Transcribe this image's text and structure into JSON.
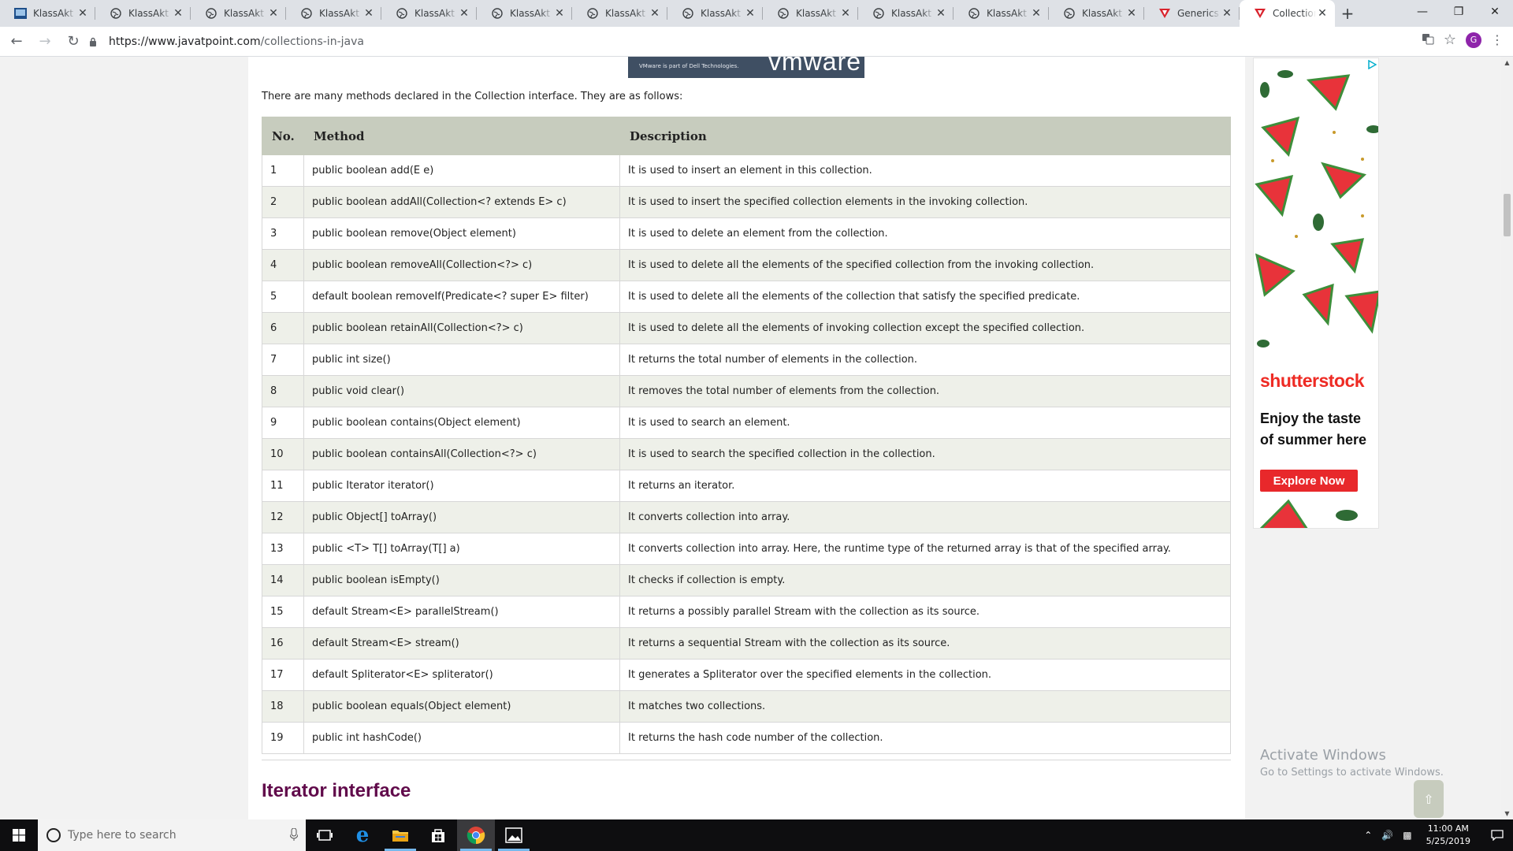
{
  "browser": {
    "tabs": [
      {
        "label": "KlassAkt Ui",
        "icon": "klassakt-favicon-icon"
      },
      {
        "label": "KlassAkt Ui",
        "icon": "globe-icon"
      },
      {
        "label": "KlassAkt Ui",
        "icon": "globe-icon"
      },
      {
        "label": "KlassAkt Ui",
        "icon": "globe-icon"
      },
      {
        "label": "KlassAkt Ui",
        "icon": "globe-icon"
      },
      {
        "label": "KlassAkt Ui",
        "icon": "globe-icon"
      },
      {
        "label": "KlassAkt Ui",
        "icon": "globe-icon"
      },
      {
        "label": "KlassAkt Ui",
        "icon": "globe-icon"
      },
      {
        "label": "KlassAkt Ui",
        "icon": "globe-icon"
      },
      {
        "label": "KlassAkt Ui",
        "icon": "globe-icon"
      },
      {
        "label": "KlassAkt Ui",
        "icon": "globe-icon"
      },
      {
        "label": "KlassAkt Ui",
        "icon": "globe-icon"
      },
      {
        "label": "Generics in",
        "icon": "javatpoint-favicon-icon"
      },
      {
        "label": "Collections",
        "icon": "javatpoint-favicon-icon"
      }
    ],
    "active_tab_index": 13,
    "new_tab": "+",
    "url_host": "https://www.javatpoint.com",
    "url_path": "/collections-in-java",
    "avatar_letter": "G"
  },
  "page": {
    "banner_small": "VMware is part of Dell Technologies.",
    "banner_big": "vmware",
    "intro": "There are many methods declared in the Collection interface. They are as follows:",
    "table": {
      "headers": [
        "No.",
        "Method",
        "Description"
      ],
      "rows": [
        {
          "no": "1",
          "method": "public boolean add(E e)",
          "desc": "It is used to insert an element in this collection."
        },
        {
          "no": "2",
          "method": "public boolean addAll(Collection<? extends E> c)",
          "desc": "It is used to insert the specified collection elements in the invoking collection."
        },
        {
          "no": "3",
          "method": "public boolean remove(Object element)",
          "desc": "It is used to delete an element from the collection."
        },
        {
          "no": "4",
          "method": "public boolean removeAll(Collection<?> c)",
          "desc": "It is used to delete all the elements of the specified collection from the invoking collection."
        },
        {
          "no": "5",
          "method": "default boolean removeIf(Predicate<? super E> filter)",
          "desc": "It is used to delete all the elements of the collection that satisfy the specified predicate."
        },
        {
          "no": "6",
          "method": "public boolean retainAll(Collection<?> c)",
          "desc": "It is used to delete all the elements of invoking collection except the specified collection."
        },
        {
          "no": "7",
          "method": "public int size()",
          "desc": "It returns the total number of elements in the collection."
        },
        {
          "no": "8",
          "method": "public void clear()",
          "desc": "It removes the total number of elements from the collection."
        },
        {
          "no": "9",
          "method": "public boolean contains(Object element)",
          "desc": "It is used to search an element."
        },
        {
          "no": "10",
          "method": "public boolean containsAll(Collection<?> c)",
          "desc": "It is used to search the specified collection in the collection."
        },
        {
          "no": "11",
          "method": "public Iterator iterator()",
          "desc": "It returns an iterator."
        },
        {
          "no": "12",
          "method": "public Object[] toArray()",
          "desc": "It converts collection into array."
        },
        {
          "no": "13",
          "method": "public <T> T[] toArray(T[] a)",
          "desc": "It converts collection into array. Here, the runtime type of the returned array is that of the specified array."
        },
        {
          "no": "14",
          "method": "public boolean isEmpty()",
          "desc": "It checks if collection is empty."
        },
        {
          "no": "15",
          "method": "default Stream<E> parallelStream()",
          "desc": "It returns a possibly parallel Stream with the collection as its source."
        },
        {
          "no": "16",
          "method": "default Stream<E> stream()",
          "desc": "It returns a sequential Stream with the collection as its source."
        },
        {
          "no": "17",
          "method": "default Spliterator<E> spliterator()",
          "desc": "It generates a Spliterator over the specified elements in the collection."
        },
        {
          "no": "18",
          "method": "public boolean equals(Object element)",
          "desc": "It matches two collections."
        },
        {
          "no": "19",
          "method": "public int hashCode()",
          "desc": "It returns the hash code number of the collection."
        }
      ]
    },
    "next_heading": "Iterator interface"
  },
  "ad": {
    "brand": "shutterstock",
    "tagline": "Enjoy the taste of summer here",
    "cta": "Explore Now"
  },
  "watermark": {
    "title": "Activate Windows",
    "subtitle": "Go to Settings to activate Windows."
  },
  "back_to_top": "⇧",
  "taskbar": {
    "search_placeholder": "Type here to search",
    "time": "11:00 AM",
    "date": "5/25/2019"
  },
  "colors": {
    "table_header": "#c7ccbe",
    "row_alt": "#eef0e9",
    "heading": "#610b4b",
    "ad_red": "#ee2b24"
  }
}
